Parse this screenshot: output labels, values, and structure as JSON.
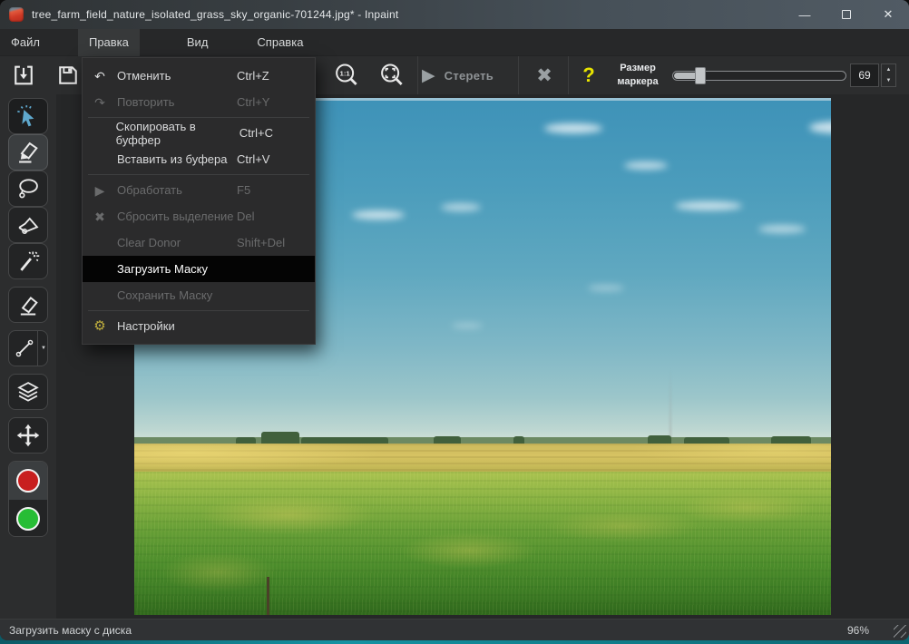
{
  "window": {
    "title": "tree_farm_field_nature_isolated_grass_sky_organic-701244.jpg* - Inpaint"
  },
  "menubar": {
    "items": [
      "Файл",
      "Правка",
      "Вид",
      "Справка"
    ]
  },
  "edit_menu": {
    "items": [
      {
        "label": "Отменить",
        "shortcut": "Ctrl+Z",
        "state": "enabled"
      },
      {
        "label": "Повторить",
        "shortcut": "Ctrl+Y",
        "state": "disabled"
      },
      {
        "label": "Скопировать в буффер",
        "shortcut": "Ctrl+C",
        "state": "enabled"
      },
      {
        "label": "Вставить из буфера",
        "shortcut": "Ctrl+V",
        "state": "enabled"
      },
      {
        "label": "Обработать",
        "shortcut": "F5",
        "state": "disabled"
      },
      {
        "label": "Сбросить выделение",
        "shortcut": "Del",
        "state": "disabled"
      },
      {
        "label": "Clear Donor",
        "shortcut": "Shift+Del",
        "state": "disabled"
      },
      {
        "label": "Загрузить Маску",
        "shortcut": "",
        "state": "highlighted"
      },
      {
        "label": "Сохранить Маску",
        "shortcut": "",
        "state": "disabled"
      },
      {
        "label": "Настройки",
        "shortcut": "",
        "state": "enabled"
      }
    ]
  },
  "toolbar": {
    "zoom_actual_label": "1:1",
    "erase_label": "Стереть",
    "help_label": "?",
    "marker_size_label_line1": "Размер",
    "marker_size_label_line2": "маркера",
    "marker_size_value": "69"
  },
  "statusbar": {
    "hint": "Загрузить маску с диска",
    "zoom_level": "96%"
  },
  "icons": {
    "undo": "↶",
    "redo": "↷",
    "play": "▶",
    "clear_selection": "✖",
    "gear": "⚙",
    "spin_up": "▲",
    "spin_down": "▼",
    "line_dropdown": "▼",
    "minimize": "—",
    "close": "✕"
  },
  "colors": {
    "cursor_tool_blue": "#5fa8cd",
    "donor_red": "#c81f1f",
    "target_green": "#27bd35",
    "help_yellow": "#e8e400",
    "gear_yellow": "#bfae3e",
    "desktop_teal": "#1593a3",
    "menu_highlight_bg": "#040404"
  }
}
